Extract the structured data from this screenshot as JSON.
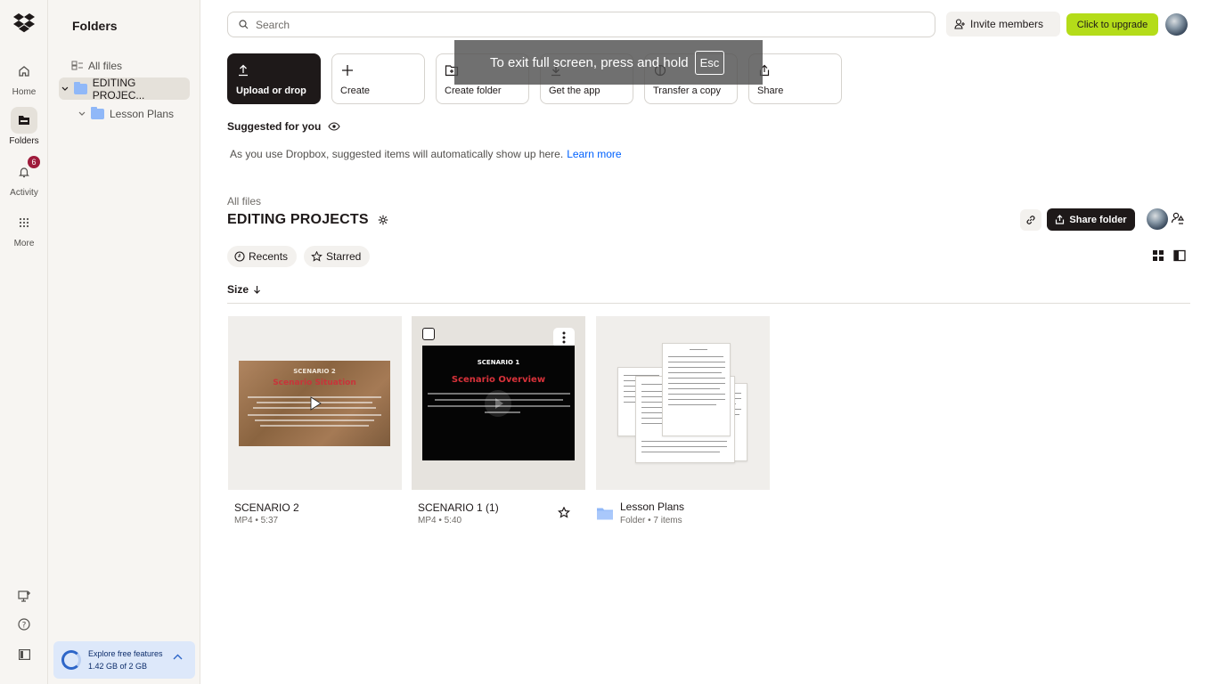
{
  "rail": {
    "items": [
      {
        "label": "Home",
        "icon": "home-icon"
      },
      {
        "label": "Folders",
        "icon": "folder-icon"
      },
      {
        "label": "Activity",
        "icon": "bell-icon",
        "badge": "6"
      },
      {
        "label": "More",
        "icon": "grid-icon"
      }
    ]
  },
  "tree": {
    "heading": "Folders",
    "all_files": "All files",
    "root": "EDITING PROJEC...",
    "child": "Lesson Plans"
  },
  "promo": {
    "title": "Explore free features",
    "usage": "1.42 GB of 2 GB"
  },
  "header": {
    "search_placeholder": "Search",
    "invite_label": "Invite members",
    "upgrade_label": "Click to upgrade"
  },
  "actions": [
    {
      "label": "Upload or drop"
    },
    {
      "label": "Create"
    },
    {
      "label": "Create folder"
    },
    {
      "label": "Get the app"
    },
    {
      "label": "Transfer a copy"
    },
    {
      "label": "Share"
    }
  ],
  "fullscreen_toast": {
    "text": "To exit full screen, press and hold",
    "key": "Esc"
  },
  "suggested": {
    "heading": "Suggested for you",
    "text": "As you use Dropbox, suggested items will automatically show up here.",
    "link": "Learn more"
  },
  "folder": {
    "breadcrumb": "All files",
    "title": "EDITING PROJECTS",
    "share_label": "Share folder"
  },
  "filters": {
    "recents": "Recents",
    "starred": "Starred"
  },
  "sort": {
    "label": "Size"
  },
  "files": [
    {
      "name": "SCENARIO 2",
      "meta": "MP4 • 5:37",
      "thumb_title": "SCENARIO 2",
      "thumb_subtitle": "Scenario Situation"
    },
    {
      "name": "SCENARIO 1 (1)",
      "meta": "MP4 • 5:40",
      "thumb_title": "SCENARIO 1",
      "thumb_subtitle": "Scenario Overview"
    },
    {
      "name": "Lesson Plans",
      "meta": "Folder • 7 items"
    }
  ],
  "colors": {
    "accent_blue": "#0061fe",
    "upgrade_green": "#b4dc19",
    "dark": "#1e1919",
    "badge": "#9e1b3b",
    "folder_blue": "#90b8f8"
  }
}
